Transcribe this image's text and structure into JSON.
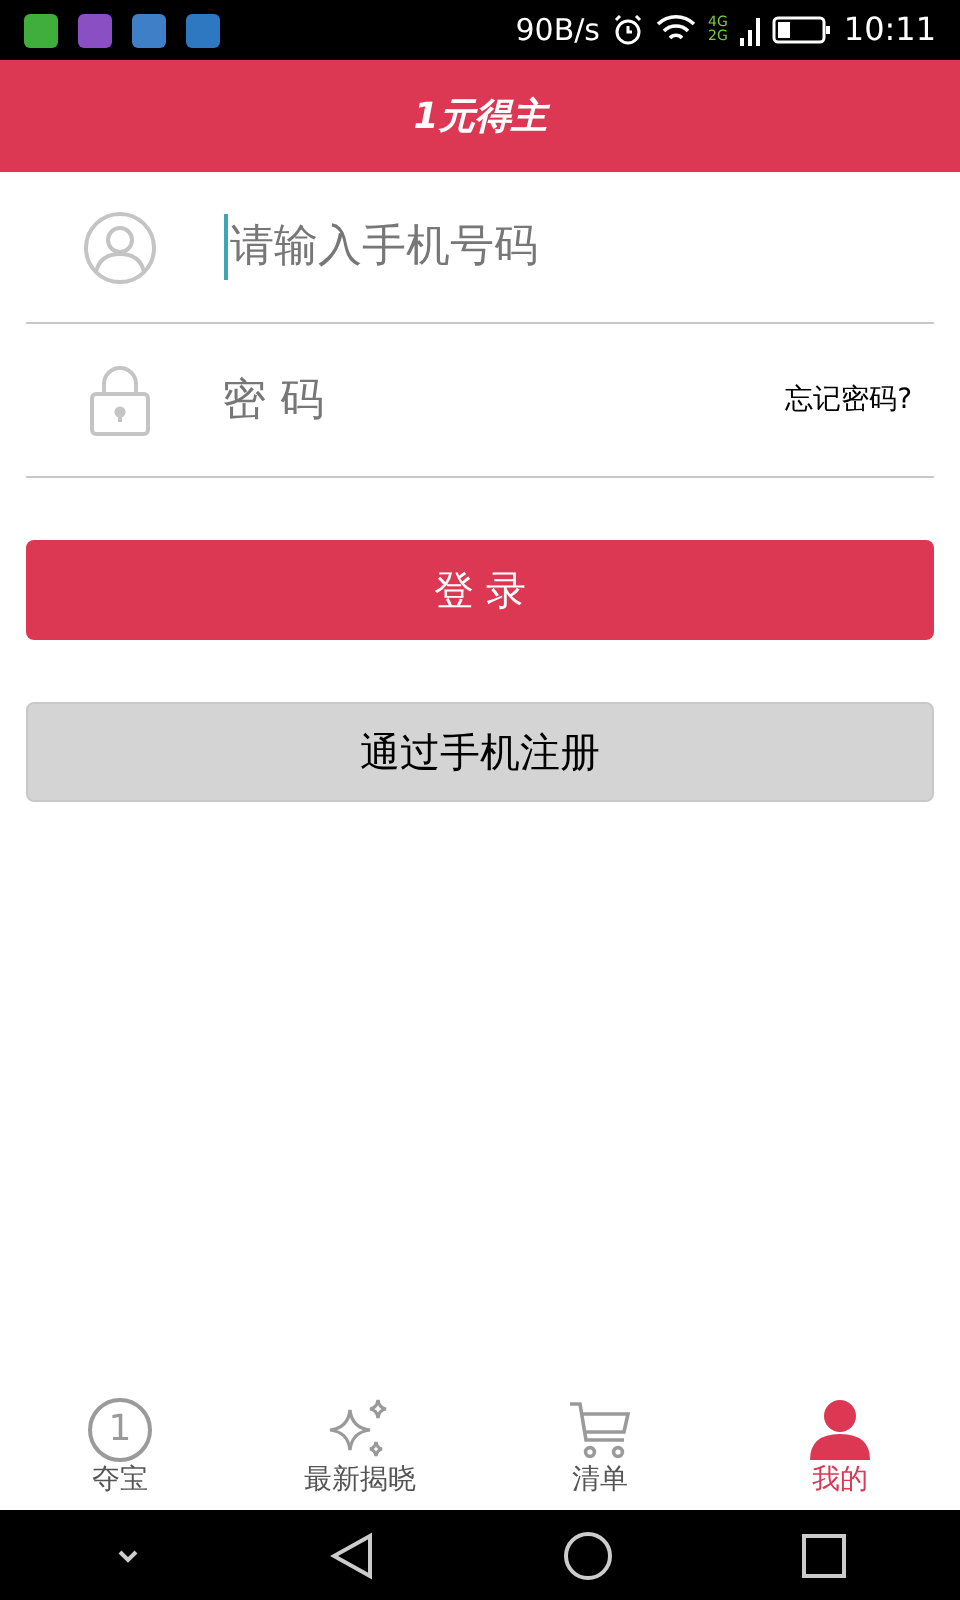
{
  "status_bar": {
    "speed": "90B/s",
    "network_top": "4G",
    "network_bottom": "2G",
    "time": "10:11"
  },
  "header": {
    "title": "1元得主"
  },
  "login_form": {
    "phone": {
      "placeholder": "请输入手机号码",
      "focused": true
    },
    "password": {
      "placeholder": "密 码"
    },
    "forgot_link": "忘记密码?"
  },
  "buttons": [
    {
      "label": "登 录",
      "kind": "primary"
    },
    {
      "label": "通过手机注册",
      "kind": "secondary"
    }
  ],
  "tabs": [
    {
      "label": "夺宝",
      "kind": "number",
      "icon_text": "1",
      "selected": false
    },
    {
      "label": "最新揭晓",
      "kind": "sparkle",
      "selected": false
    },
    {
      "label": "清单",
      "kind": "cart",
      "selected": false
    },
    {
      "label": "我的",
      "kind": "person",
      "selected": true
    }
  ]
}
